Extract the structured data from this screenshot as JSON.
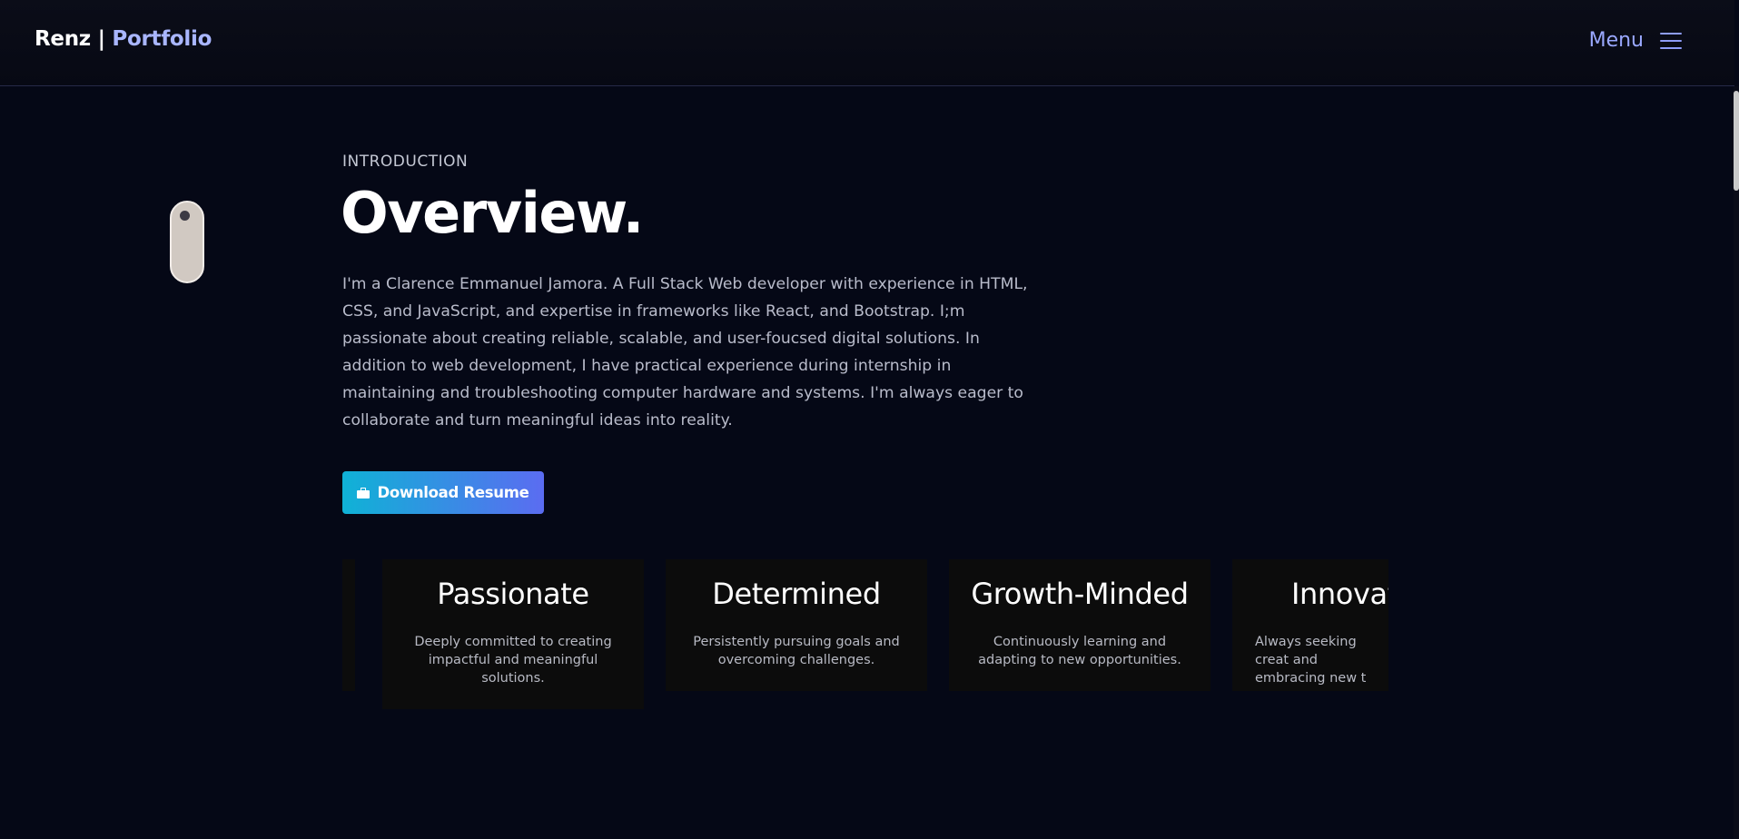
{
  "nav": {
    "brand_name": "Renz |",
    "brand_accent": "Portfolio",
    "menu_label": "Menu"
  },
  "hero": {
    "eyebrow": "INTRODUCTION",
    "title": "Overview.",
    "paragraph": "I'm a Clarence Emmanuel Jamora. A Full Stack Web developer with experience in HTML, CSS, and JavaScript, and expertise in frameworks like React, and Bootstrap. I;m passionate about creating reliable, scalable, and user-foucsed digital solutions. In addition to web development, I have practical experience during internship in maintaining and troubleshooting computer hardware and systems. I'm always eager to collaborate and turn meaningful ideas into reality.",
    "download_button": "Download Resume"
  },
  "traits": [
    {
      "title": "Passionate",
      "desc": "Deeply committed to creating impactful and meaningful solutions."
    },
    {
      "title": "Determined",
      "desc": "Persistently pursuing goals and overcoming challenges."
    },
    {
      "title": "Growth-Minded",
      "desc": "Continuously learning and adapting to new opportunities."
    },
    {
      "title": "Innovat",
      "desc": "Always seeking creat and embracing new t"
    }
  ],
  "colors": {
    "background": "#050816",
    "accent": "#9aa8ff",
    "button_start": "#0fb2d6",
    "button_end": "#5b6cf1",
    "card_bg": "#0c0c0c"
  },
  "icons": {
    "menu": "hamburger-icon",
    "resume": "briefcase-icon",
    "scroll": "mouse-scroll-icon"
  }
}
